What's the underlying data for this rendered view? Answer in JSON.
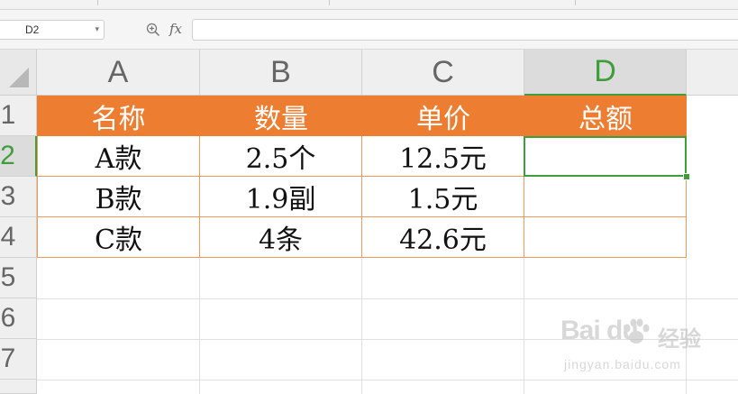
{
  "formula_bar": {
    "name_box": "D2",
    "fx_label": "fx",
    "formula": ""
  },
  "columns": [
    "A",
    "B",
    "C",
    "D"
  ],
  "active_column": "D",
  "rows": [
    "1",
    "2",
    "3",
    "4",
    "5",
    "6",
    "7"
  ],
  "active_row": "2",
  "table": {
    "headers": [
      "名称",
      "数量",
      "单价",
      "总额"
    ],
    "data": [
      [
        "A款",
        "2.5个",
        "12.5元",
        ""
      ],
      [
        "B款",
        "1.9副",
        "1.5元",
        ""
      ],
      [
        "C款",
        "4条",
        "42.6元",
        ""
      ]
    ]
  },
  "colors": {
    "header_fill": "#ed7d31",
    "header_text": "#ffffff",
    "selection": "#3f9d3a"
  },
  "watermark": {
    "logo": "Bai du",
    "brand": "经验",
    "url": "jingyan.baidu.com"
  }
}
